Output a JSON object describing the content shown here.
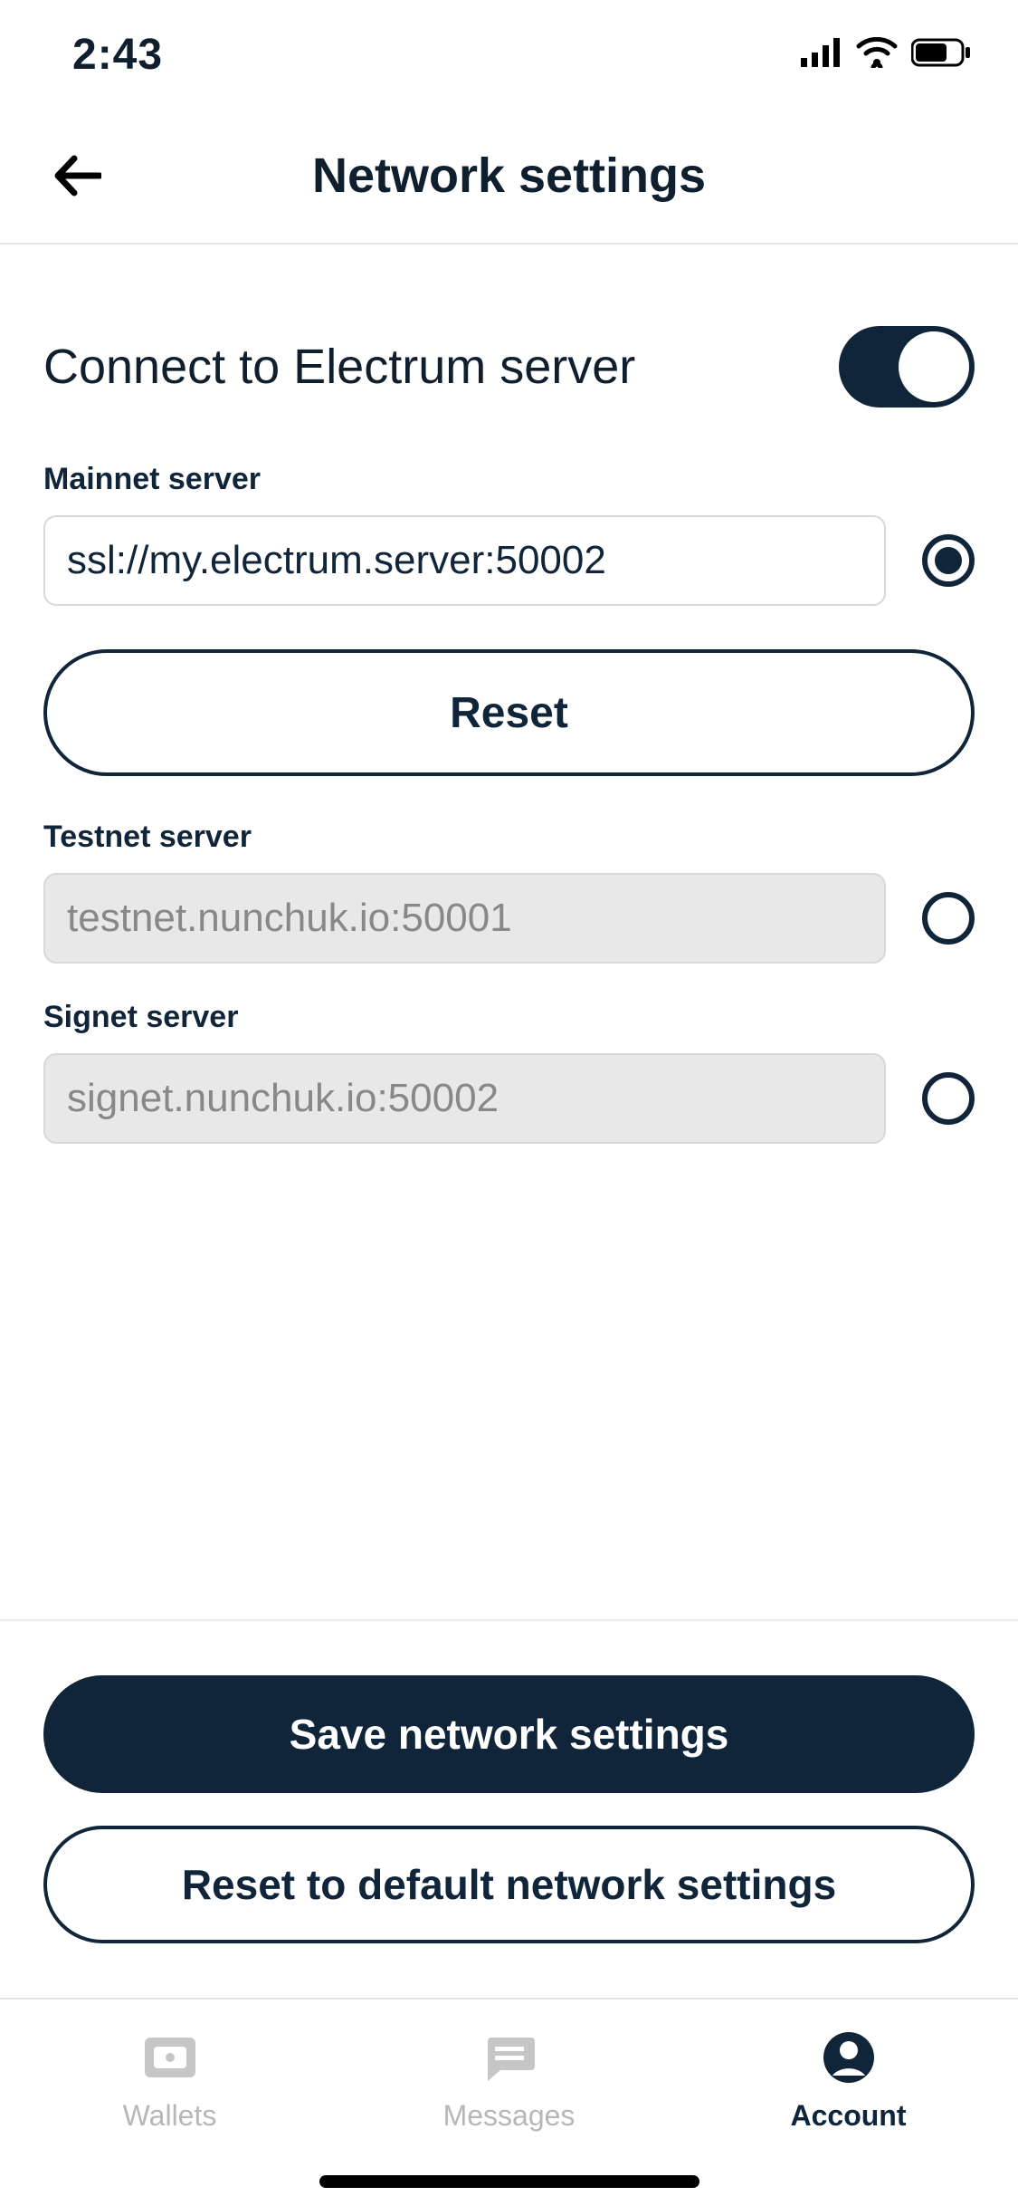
{
  "status": {
    "time": "2:43"
  },
  "header": {
    "title": "Network settings"
  },
  "connect": {
    "label": "Connect to Electrum server",
    "enabled": true
  },
  "servers": {
    "mainnet": {
      "label": "Mainnet server",
      "value": "ssl://my.electrum.server:50002",
      "selected": true,
      "enabled": true
    },
    "testnet": {
      "label": "Testnet server",
      "value": "testnet.nunchuk.io:50001",
      "selected": false,
      "enabled": false
    },
    "signet": {
      "label": "Signet server",
      "value": "signet.nunchuk.io:50002",
      "selected": false,
      "enabled": false
    }
  },
  "buttons": {
    "reset_mainnet": "Reset",
    "save": "Save network settings",
    "reset_defaults": "Reset to default network settings"
  },
  "tabs": {
    "wallets": "Wallets",
    "messages": "Messages",
    "account": "Account",
    "active": "account"
  }
}
